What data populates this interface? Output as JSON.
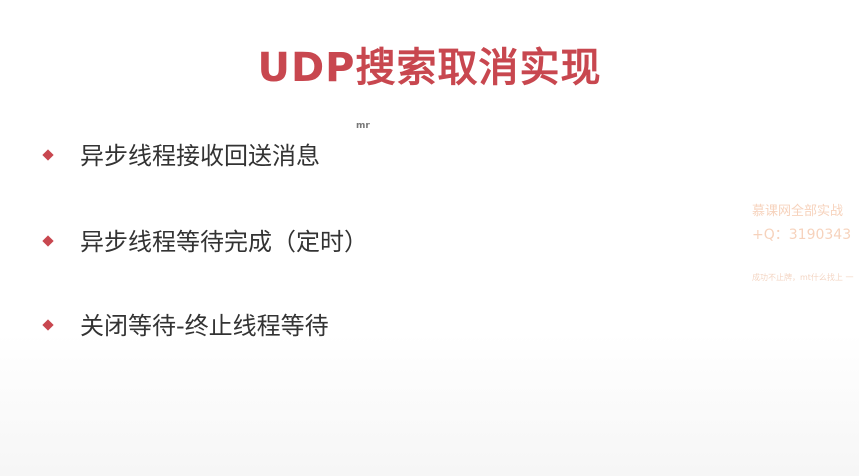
{
  "slide": {
    "title": "UDP搜索取消实现",
    "mark": "mr",
    "bullets": [
      "异步线程接收回送消息",
      "异步线程等待完成（定时）",
      "关闭等待-终止线程等待"
    ]
  },
  "watermark": {
    "line1": "慕课网全部实战",
    "line2": "+Q：3190343",
    "line3": "成功不止牌，mt什么找上 一"
  },
  "colors": {
    "accent": "#c8474f",
    "text": "#333333",
    "watermark": "#f4c4a6"
  }
}
